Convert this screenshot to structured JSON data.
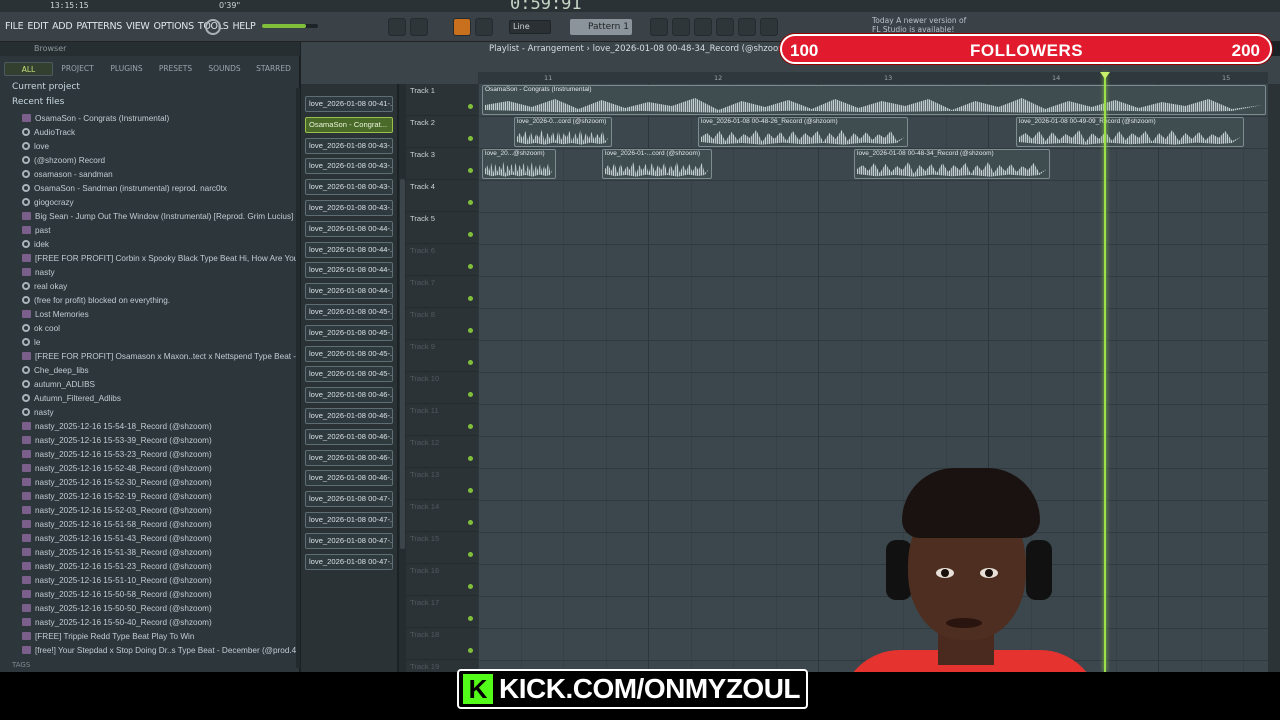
{
  "top": {
    "clock": "13:15:15",
    "small_position": "0'39\"",
    "time_display": "0:59:91",
    "menu": [
      "FILE",
      "EDIT",
      "ADD",
      "PATTERNS",
      "VIEW",
      "OPTIONS",
      "TOOLS",
      "HELP"
    ],
    "snap": "Line",
    "pattern": "Pattern 1",
    "news_line1": "Today  A newer version of",
    "news_line2": "FL Studio is available!"
  },
  "followers": {
    "current": "100",
    "label": "FOLLOWERS",
    "goal": "200"
  },
  "browser": {
    "header": "Browser",
    "tabs": [
      "ALL",
      "PROJECT",
      "PLUGINS",
      "PRESETS",
      "SOUNDS",
      "STARRED"
    ],
    "active_tab": "ALL",
    "current_project": "Current project",
    "recent_files": "Recent files",
    "files": [
      {
        "name": "OsamaSon - Congrats (Instrumental)",
        "icon": "wave"
      },
      {
        "name": "AudioTrack",
        "icon": "gear"
      },
      {
        "name": "love",
        "icon": "gear"
      },
      {
        "name": "(@shzoom) Record",
        "icon": "gear"
      },
      {
        "name": "osamason - sandman",
        "icon": "gear"
      },
      {
        "name": "OsamaSon - Sandman (instrumental) reprod. narc0tx",
        "icon": "gear"
      },
      {
        "name": "giogocrazy",
        "icon": "gear"
      },
      {
        "name": "Big Sean - Jump Out The Window (Instrumental) [Reprod. Grim Lucius] Best",
        "icon": "wave"
      },
      {
        "name": "past",
        "icon": "wave"
      },
      {
        "name": "idek",
        "icon": "gear"
      },
      {
        "name": "[FREE FOR PROFIT] Corbin x Spooky Black Type Beat Hi, How Are You_ (1)",
        "icon": "wave"
      },
      {
        "name": "nasty",
        "icon": "wave"
      },
      {
        "name": "real okay",
        "icon": "gear"
      },
      {
        "name": "(free for profit) blocked on everything.",
        "icon": "gear"
      },
      {
        "name": "Lost Memories",
        "icon": "wave"
      },
      {
        "name": "ok cool",
        "icon": "gear"
      },
      {
        "name": "le",
        "icon": "gear"
      },
      {
        "name": "[FREE FOR PROFIT] Osamason x Maxon..tect x Nettspend Type Beat - Coughing",
        "icon": "wave"
      },
      {
        "name": "Che_deep_libs",
        "icon": "gear"
      },
      {
        "name": "autumn_ADLIBS",
        "icon": "gear"
      },
      {
        "name": "Autumn_Filtered_Adlibs",
        "icon": "gear"
      },
      {
        "name": "nasty",
        "icon": "gear"
      },
      {
        "name": "nasty_2025-12-16 15-54-18_Record (@shzoom)",
        "icon": "wave"
      },
      {
        "name": "nasty_2025-12-16 15-53-39_Record (@shzoom)",
        "icon": "wave"
      },
      {
        "name": "nasty_2025-12-16 15-53-23_Record (@shzoom)",
        "icon": "wave"
      },
      {
        "name": "nasty_2025-12-16 15-52-48_Record (@shzoom)",
        "icon": "wave"
      },
      {
        "name": "nasty_2025-12-16 15-52-30_Record (@shzoom)",
        "icon": "wave"
      },
      {
        "name": "nasty_2025-12-16 15-52-19_Record (@shzoom)",
        "icon": "wave"
      },
      {
        "name": "nasty_2025-12-16 15-52-03_Record (@shzoom)",
        "icon": "wave"
      },
      {
        "name": "nasty_2025-12-16 15-51-58_Record (@shzoom)",
        "icon": "wave"
      },
      {
        "name": "nasty_2025-12-16 15-51-43_Record (@shzoom)",
        "icon": "wave"
      },
      {
        "name": "nasty_2025-12-16 15-51-38_Record (@shzoom)",
        "icon": "wave"
      },
      {
        "name": "nasty_2025-12-16 15-51-23_Record (@shzoom)",
        "icon": "wave"
      },
      {
        "name": "nasty_2025-12-16 15-51-10_Record (@shzoom)",
        "icon": "wave"
      },
      {
        "name": "nasty_2025-12-16 15-50-58_Record (@shzoom)",
        "icon": "wave"
      },
      {
        "name": "nasty_2025-12-16 15-50-50_Record (@shzoom)",
        "icon": "wave"
      },
      {
        "name": "nasty_2025-12-16 15-50-40_Record (@shzoom)",
        "icon": "wave"
      },
      {
        "name": "[FREE] Trippie Redd Type Beat Play To Win",
        "icon": "wave"
      },
      {
        "name": "[free!] Your Stepdad x Stop Doing Dr..s Type Beat - December (@prod.4head)",
        "icon": "wave"
      }
    ],
    "tags": "TAGS"
  },
  "clips": [
    "love_2026-01-08 00-41-...",
    "OsamaSon - Congrat...",
    "love_2026-01-08 00-43-...",
    "love_2026-01-08 00-43-...",
    "love_2026-01-08 00-43-...",
    "love_2026-01-08 00-43-...",
    "love_2026-01-08 00-44-...",
    "love_2026-01-08 00-44-...",
    "love_2026-01-08 00-44-...",
    "love_2026-01-08 00-44-...",
    "love_2026-01-08 00-45-...",
    "love_2026-01-08 00-45-...",
    "love_2026-01-08 00-45-...",
    "love_2026-01-08 00-45-...",
    "love_2026-01-08 00-46-...",
    "love_2026-01-08 00-46-...",
    "love_2026-01-08 00-46-...",
    "love_2026-01-08 00-46-...",
    "love_2026-01-08 00-46-...",
    "love_2026-01-08 00-47-...",
    "love_2026-01-08 00-47-...",
    "love_2026-01-08 00-47-...",
    "love_2026-01-08 00-47-..."
  ],
  "selected_clip_index": 1,
  "playlist": {
    "title": "Playlist - Arrangement › love_2026-01-08 00-48-34_Record (@shzoom)",
    "ruler": [
      "11",
      "12",
      "13",
      "14",
      "15"
    ],
    "tracks": [
      "Track 1",
      "Track 2",
      "Track 3",
      "Track 4",
      "Track 5",
      "Track 6",
      "Track 7",
      "Track 8",
      "Track 9",
      "Track 10",
      "Track 11",
      "Track 12",
      "Track 13",
      "Track 14",
      "Track 15",
      "Track 16",
      "Track 17",
      "Track 18",
      "Track 19"
    ],
    "clips": [
      {
        "track": 0,
        "label": "OsamaSon - Congrats (Instrumental)"
      },
      {
        "track": 1,
        "label": "love_2026-0...cord (@shzoom)"
      },
      {
        "track": 1,
        "label": "love_2026-01-08 00-48-26_Record (@shzoom)"
      },
      {
        "track": 1,
        "label": "love_2026-01-08 00-49-09_Record (@shzoom)"
      },
      {
        "track": 2,
        "label": "love_20...@shzoom)"
      },
      {
        "track": 2,
        "label": "love_2026-01-...cord (@shzoom)"
      },
      {
        "track": 2,
        "label": "love_2026-01-08 00-48-34_Record (@shzoom)"
      }
    ]
  },
  "overlay": {
    "kick": "KICK.COM/ONMYZOUL"
  }
}
